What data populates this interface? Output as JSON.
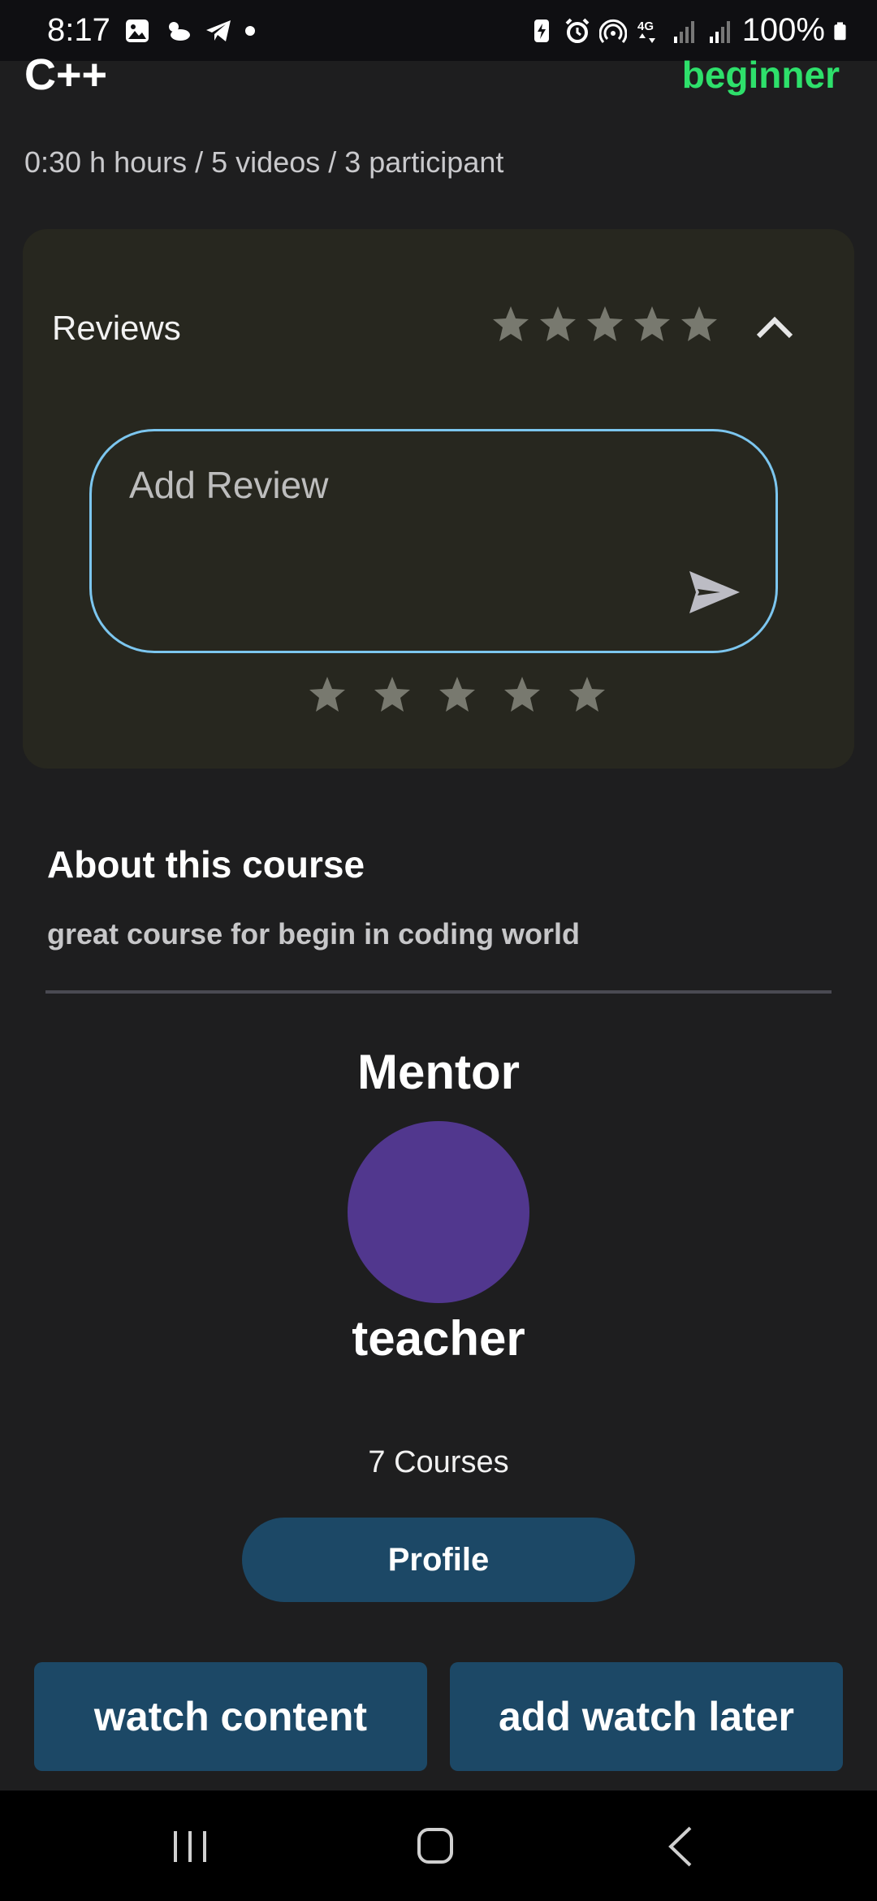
{
  "status_bar": {
    "time": "8:17",
    "battery": "100%",
    "network": "4G",
    "left_icons": [
      "gallery-icon",
      "weather-icon",
      "telegram-icon",
      "dot-icon"
    ],
    "right_icons": [
      "battery-saver-icon",
      "alarm-icon",
      "hotspot-icon",
      "network-4g-icon",
      "signal-icon",
      "signal-icon",
      "battery-icon"
    ]
  },
  "course": {
    "title": "C++",
    "level": "beginner",
    "meta": "0:30 h hours / 5 videos / 3 participant"
  },
  "reviews": {
    "label": "Reviews",
    "average_stars": 0,
    "max_stars": 5,
    "collapse_icon": "chevron-up-icon",
    "input_placeholder": "Add Review",
    "input_value": "",
    "send_icon": "send-icon",
    "rating_stars_selected": 0
  },
  "about": {
    "title": "About this course",
    "description": "great course for begin in coding world"
  },
  "mentor": {
    "heading": "Mentor",
    "name": "teacher",
    "courses": "7 Courses",
    "profile_label": "Profile",
    "avatar_color": "#51378e"
  },
  "actions": {
    "watch_label": "watch content",
    "later_label": "add watch later"
  },
  "colors": {
    "background": "#1e1e1f",
    "card": "#27271f",
    "accent_green": "#2ee06b",
    "button": "#1c4866",
    "input_border": "#7cc6ef",
    "star_inactive": "#78796f"
  },
  "nav_bar": {
    "icons": [
      "recents-icon",
      "home-icon",
      "back-icon"
    ]
  }
}
